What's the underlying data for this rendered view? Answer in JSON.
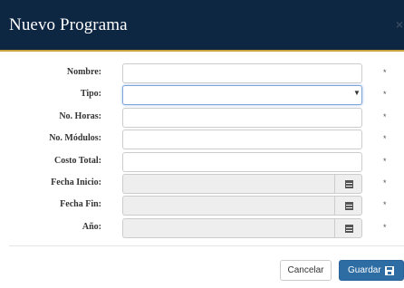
{
  "modal": {
    "title": "Nuevo Programa",
    "close_glyph": "×"
  },
  "form": {
    "fields": [
      {
        "label": "Nombre:",
        "type": "text",
        "value": "",
        "required_mark": "*"
      },
      {
        "label": "Tipo:",
        "type": "select",
        "value": "",
        "required_mark": "*"
      },
      {
        "label": "No. Horas:",
        "type": "text",
        "value": "",
        "required_mark": "*"
      },
      {
        "label": "No. Módulos:",
        "type": "text",
        "value": "",
        "required_mark": "*"
      },
      {
        "label": "Costo Total:",
        "type": "text",
        "value": "",
        "required_mark": "*"
      },
      {
        "label": "Fecha Inicio:",
        "type": "date",
        "value": "",
        "required_mark": "*"
      },
      {
        "label": "Fecha Fin:",
        "type": "date",
        "value": "",
        "required_mark": "*"
      },
      {
        "label": "Año:",
        "type": "date",
        "value": "",
        "required_mark": "*"
      }
    ],
    "select_arrow": "▼",
    "calendar_icon": "calendar-icon"
  },
  "footer": {
    "cancel_label": "Cancelar",
    "save_label": "Guardar",
    "save_icon": "floppy-disk-icon"
  },
  "colors": {
    "header_bg": "#0d2642",
    "header_accent": "#c9a23b",
    "primary_button": "#2e6da4"
  }
}
